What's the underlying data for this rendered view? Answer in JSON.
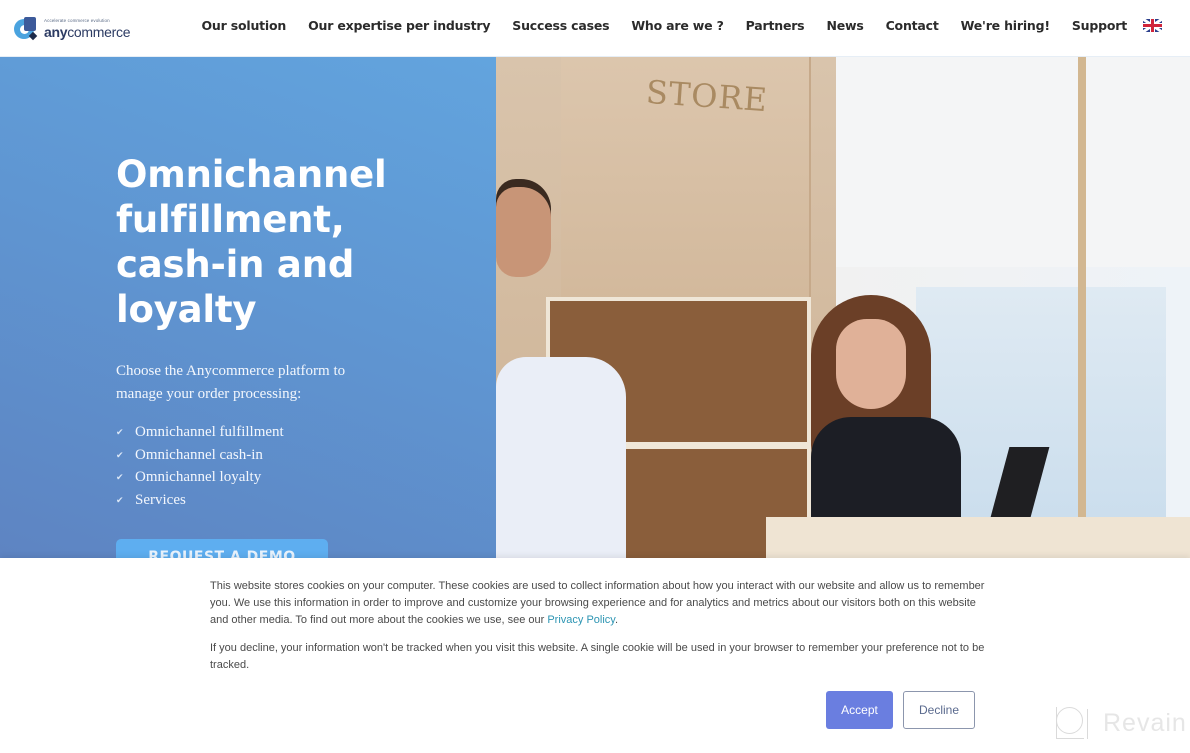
{
  "brand": {
    "tagline": "Accelerate commerce evolution",
    "name_bold": "any",
    "name_regular": "commerce"
  },
  "nav": {
    "items": [
      {
        "label": "Our solution"
      },
      {
        "label": "Our expertise per industry"
      },
      {
        "label": "Success cases"
      },
      {
        "label": "Who are we ?"
      },
      {
        "label": "Partners"
      },
      {
        "label": "News"
      },
      {
        "label": "Contact"
      },
      {
        "label": "We're hiring!"
      },
      {
        "label": "Support"
      }
    ],
    "language_icon": "uk-flag-icon"
  },
  "hero": {
    "title": "Omnichannel fulfillment, cash-in and loyalty",
    "subtitle": "Choose the Anycommerce platform to manage your order processing:",
    "features": [
      {
        "icon": "check-icon",
        "glyph": "✔",
        "label": "Omnichannel fulfillment"
      },
      {
        "icon": "check-icon",
        "glyph": "✔",
        "label": "Omnichannel cash-in"
      },
      {
        "icon": "check-icon",
        "glyph": "✔",
        "label": "Omnichannel loyalty"
      },
      {
        "icon": "check-icon",
        "glyph": "✔",
        "label": "Services"
      }
    ],
    "cta_label": "REQUEST A DEMO",
    "photo_sign": "STORE",
    "colors": {
      "gradient_light": "#62a4de",
      "gradient_dark": "#5e84c2",
      "cta": "#5eaef0"
    }
  },
  "cookie_banner": {
    "paragraph1_text": "This website stores cookies on your computer. These cookies are used to collect information about how you interact with our website and allow us to remember you. We use this information in order to improve and customize your browsing experience and for analytics and metrics about our visitors both on this website and other media. To find out more about the cookies we use, see our ",
    "privacy_link": "Privacy Policy",
    "paragraph1_end": ".",
    "paragraph2": "If you decline, your information won't be tracked when you visit this website. A single cookie will be used in your browser to remember your preference not to be tracked.",
    "accept_label": "Accept",
    "decline_label": "Decline",
    "colors": {
      "accept": "#6a7ee0",
      "link": "#2d95b3"
    }
  },
  "watermark": {
    "text": "Revain"
  }
}
